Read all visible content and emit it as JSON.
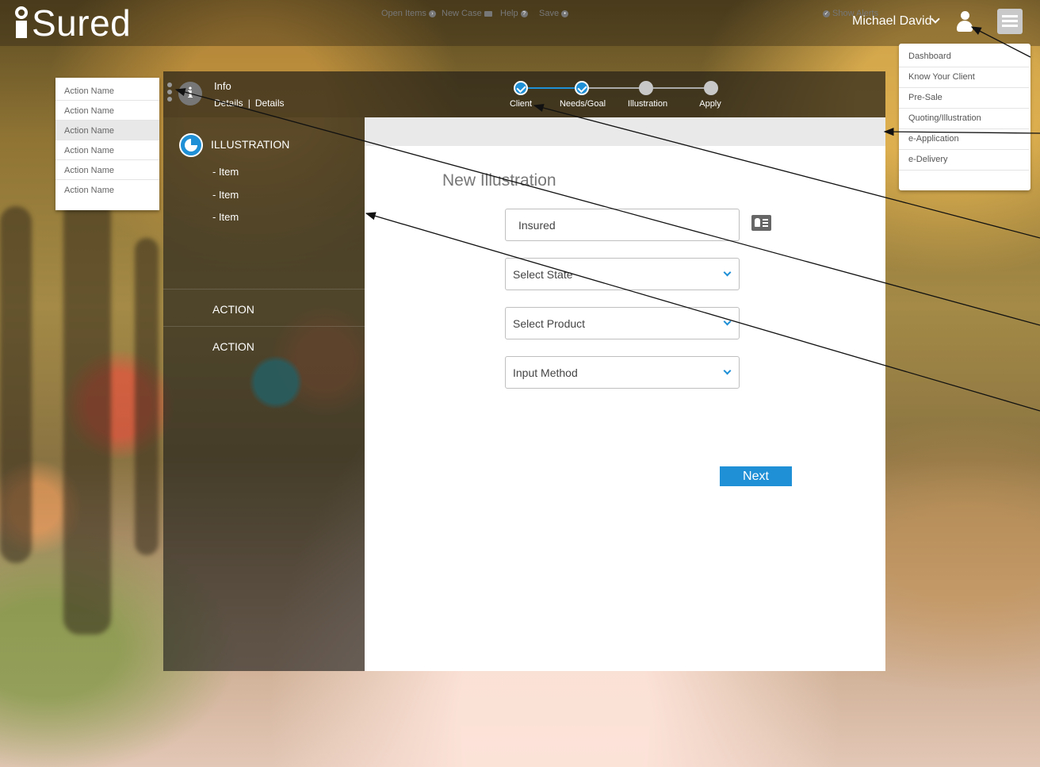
{
  "app": {
    "logo": "Sured"
  },
  "header": {
    "user_name": "Michael David"
  },
  "nav_menu": {
    "items": [
      "Dashboard",
      "Know Your Client",
      "Pre-Sale",
      "Quoting/Illustration",
      "e-Application",
      "e-Delivery"
    ]
  },
  "action_menu": {
    "items": [
      "Action Name",
      "Action Name",
      "Action Name",
      "Action Name",
      "Action Name",
      "Action Name"
    ],
    "active_index": 2
  },
  "info": {
    "title": "Info",
    "details_1": "Details",
    "separator": "|",
    "details_2": "Details"
  },
  "stepper": {
    "steps": [
      {
        "label": "Client",
        "done": true
      },
      {
        "label": "Needs/Goal",
        "done": true
      },
      {
        "label": "Illustration",
        "done": false
      },
      {
        "label": "Apply",
        "done": false
      }
    ]
  },
  "sidebar": {
    "title": "ILLUSTRATION",
    "items": [
      "- Item",
      "- Item",
      "- Item"
    ],
    "actions": [
      "ACTION",
      "ACTION"
    ]
  },
  "toolbar": {
    "open_items": "Open Items",
    "new_case": "New Case",
    "help": "Help",
    "save": "Save",
    "show_alerts": "Show Alerts"
  },
  "form": {
    "title": "New Illustration",
    "insured_value": "Insured",
    "state_value": "Select State",
    "product_value": "Select Product",
    "input_method_value": "Input Method",
    "next_label": "Next"
  },
  "colors": {
    "accent": "#1f8fd6"
  }
}
